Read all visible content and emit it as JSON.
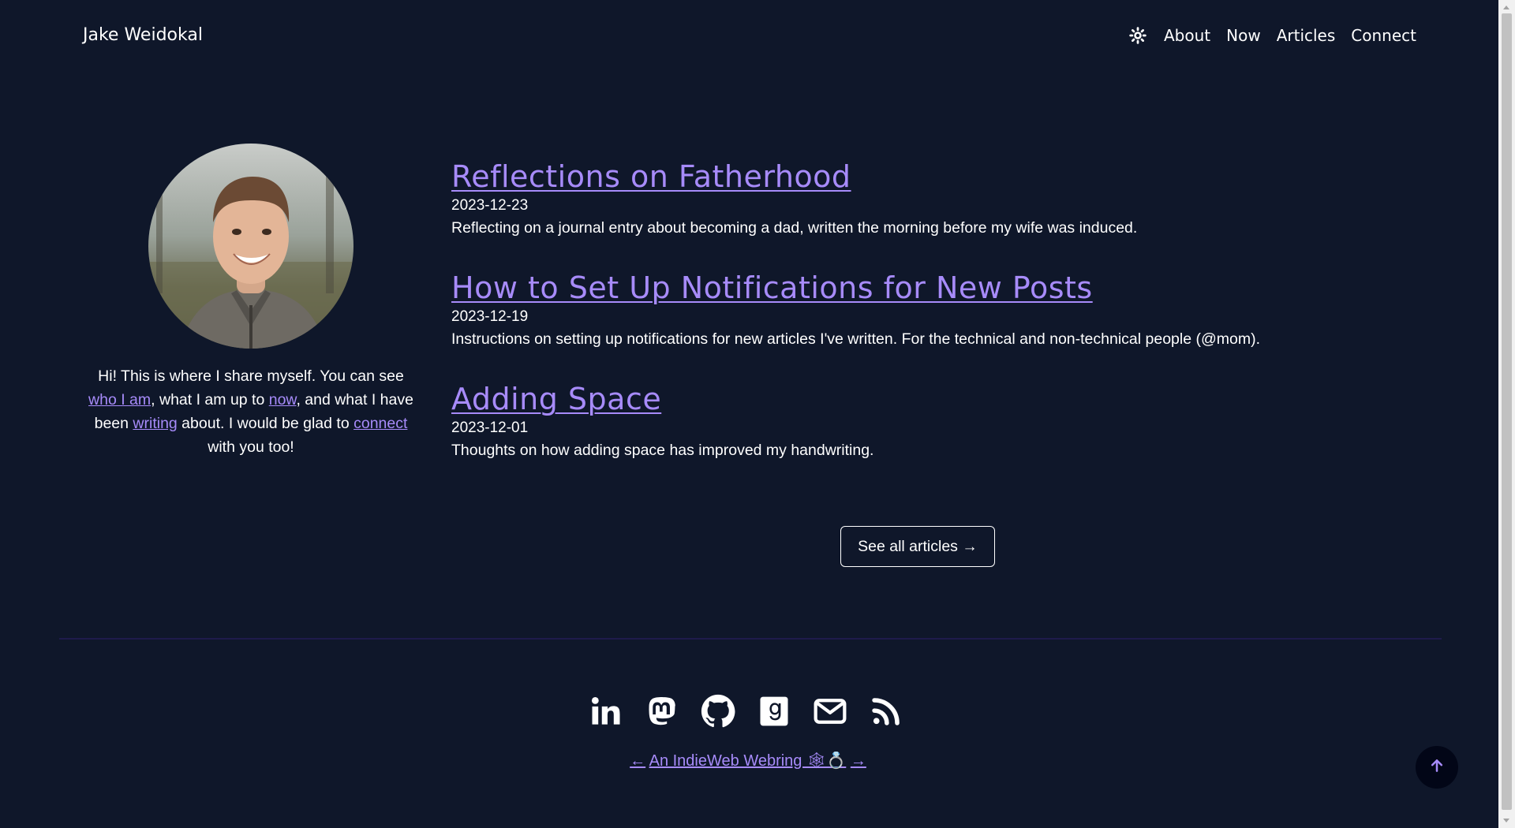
{
  "header": {
    "site_title": "Jake Weidokal",
    "theme_icon": "sun-icon",
    "nav": [
      {
        "label": "About"
      },
      {
        "label": "Now"
      },
      {
        "label": "Articles"
      },
      {
        "label": "Connect"
      }
    ]
  },
  "profile": {
    "bio_text_1": "Hi! This is where I share myself. You can see ",
    "link_who": "who I am",
    "bio_text_2": ", what I am up to ",
    "link_now": "now",
    "bio_text_3": ", and what I have been ",
    "link_writing": "writing",
    "bio_text_4": " about. I would be glad to ",
    "link_connect": "connect",
    "bio_text_5": " with you too!"
  },
  "articles": [
    {
      "title": "Reflections on Fatherhood",
      "date": "2023-12-23",
      "description": "Reflecting on a journal entry about becoming a dad, written the morning before my wife was induced."
    },
    {
      "title": "How to Set Up Notifications for New Posts",
      "date": "2023-12-19",
      "description": "Instructions on setting up notifications for new articles I've written. For the technical and non-technical people (@mom)."
    },
    {
      "title": "Adding Space",
      "date": "2023-12-01",
      "description": "Thoughts on how adding space has improved my handwriting."
    }
  ],
  "see_all_label": "See all articles →",
  "footer": {
    "social_icons": [
      "linkedin-icon",
      "mastodon-icon",
      "github-icon",
      "goodreads-icon",
      "email-icon",
      "rss-icon"
    ],
    "webring_prev": "←",
    "webring_label": "An IndieWeb Webring 🕸💍",
    "webring_next": "→"
  },
  "colors": {
    "background": "#0f172a",
    "link": "#a78bfa",
    "text": "#ffffff"
  }
}
